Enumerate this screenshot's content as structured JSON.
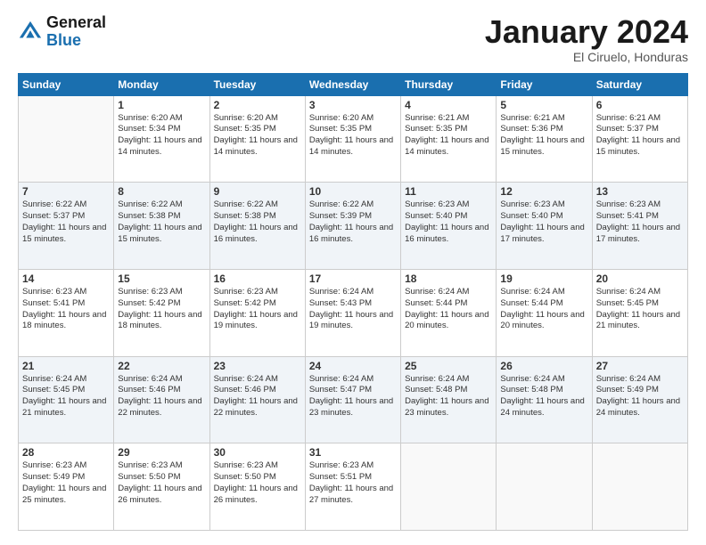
{
  "logo": {
    "general": "General",
    "blue": "Blue"
  },
  "header": {
    "month": "January 2024",
    "location": "El Ciruelo, Honduras"
  },
  "weekdays": [
    "Sunday",
    "Monday",
    "Tuesday",
    "Wednesday",
    "Thursday",
    "Friday",
    "Saturday"
  ],
  "weeks": [
    [
      {
        "day": "",
        "sunrise": "",
        "sunset": "",
        "daylight": ""
      },
      {
        "day": "1",
        "sunrise": "Sunrise: 6:20 AM",
        "sunset": "Sunset: 5:34 PM",
        "daylight": "Daylight: 11 hours and 14 minutes."
      },
      {
        "day": "2",
        "sunrise": "Sunrise: 6:20 AM",
        "sunset": "Sunset: 5:35 PM",
        "daylight": "Daylight: 11 hours and 14 minutes."
      },
      {
        "day": "3",
        "sunrise": "Sunrise: 6:20 AM",
        "sunset": "Sunset: 5:35 PM",
        "daylight": "Daylight: 11 hours and 14 minutes."
      },
      {
        "day": "4",
        "sunrise": "Sunrise: 6:21 AM",
        "sunset": "Sunset: 5:35 PM",
        "daylight": "Daylight: 11 hours and 14 minutes."
      },
      {
        "day": "5",
        "sunrise": "Sunrise: 6:21 AM",
        "sunset": "Sunset: 5:36 PM",
        "daylight": "Daylight: 11 hours and 15 minutes."
      },
      {
        "day": "6",
        "sunrise": "Sunrise: 6:21 AM",
        "sunset": "Sunset: 5:37 PM",
        "daylight": "Daylight: 11 hours and 15 minutes."
      }
    ],
    [
      {
        "day": "7",
        "sunrise": "Sunrise: 6:22 AM",
        "sunset": "Sunset: 5:37 PM",
        "daylight": "Daylight: 11 hours and 15 minutes."
      },
      {
        "day": "8",
        "sunrise": "Sunrise: 6:22 AM",
        "sunset": "Sunset: 5:38 PM",
        "daylight": "Daylight: 11 hours and 15 minutes."
      },
      {
        "day": "9",
        "sunrise": "Sunrise: 6:22 AM",
        "sunset": "Sunset: 5:38 PM",
        "daylight": "Daylight: 11 hours and 16 minutes."
      },
      {
        "day": "10",
        "sunrise": "Sunrise: 6:22 AM",
        "sunset": "Sunset: 5:39 PM",
        "daylight": "Daylight: 11 hours and 16 minutes."
      },
      {
        "day": "11",
        "sunrise": "Sunrise: 6:23 AM",
        "sunset": "Sunset: 5:40 PM",
        "daylight": "Daylight: 11 hours and 16 minutes."
      },
      {
        "day": "12",
        "sunrise": "Sunrise: 6:23 AM",
        "sunset": "Sunset: 5:40 PM",
        "daylight": "Daylight: 11 hours and 17 minutes."
      },
      {
        "day": "13",
        "sunrise": "Sunrise: 6:23 AM",
        "sunset": "Sunset: 5:41 PM",
        "daylight": "Daylight: 11 hours and 17 minutes."
      }
    ],
    [
      {
        "day": "14",
        "sunrise": "Sunrise: 6:23 AM",
        "sunset": "Sunset: 5:41 PM",
        "daylight": "Daylight: 11 hours and 18 minutes."
      },
      {
        "day": "15",
        "sunrise": "Sunrise: 6:23 AM",
        "sunset": "Sunset: 5:42 PM",
        "daylight": "Daylight: 11 hours and 18 minutes."
      },
      {
        "day": "16",
        "sunrise": "Sunrise: 6:23 AM",
        "sunset": "Sunset: 5:42 PM",
        "daylight": "Daylight: 11 hours and 19 minutes."
      },
      {
        "day": "17",
        "sunrise": "Sunrise: 6:24 AM",
        "sunset": "Sunset: 5:43 PM",
        "daylight": "Daylight: 11 hours and 19 minutes."
      },
      {
        "day": "18",
        "sunrise": "Sunrise: 6:24 AM",
        "sunset": "Sunset: 5:44 PM",
        "daylight": "Daylight: 11 hours and 20 minutes."
      },
      {
        "day": "19",
        "sunrise": "Sunrise: 6:24 AM",
        "sunset": "Sunset: 5:44 PM",
        "daylight": "Daylight: 11 hours and 20 minutes."
      },
      {
        "day": "20",
        "sunrise": "Sunrise: 6:24 AM",
        "sunset": "Sunset: 5:45 PM",
        "daylight": "Daylight: 11 hours and 21 minutes."
      }
    ],
    [
      {
        "day": "21",
        "sunrise": "Sunrise: 6:24 AM",
        "sunset": "Sunset: 5:45 PM",
        "daylight": "Daylight: 11 hours and 21 minutes."
      },
      {
        "day": "22",
        "sunrise": "Sunrise: 6:24 AM",
        "sunset": "Sunset: 5:46 PM",
        "daylight": "Daylight: 11 hours and 22 minutes."
      },
      {
        "day": "23",
        "sunrise": "Sunrise: 6:24 AM",
        "sunset": "Sunset: 5:46 PM",
        "daylight": "Daylight: 11 hours and 22 minutes."
      },
      {
        "day": "24",
        "sunrise": "Sunrise: 6:24 AM",
        "sunset": "Sunset: 5:47 PM",
        "daylight": "Daylight: 11 hours and 23 minutes."
      },
      {
        "day": "25",
        "sunrise": "Sunrise: 6:24 AM",
        "sunset": "Sunset: 5:48 PM",
        "daylight": "Daylight: 11 hours and 23 minutes."
      },
      {
        "day": "26",
        "sunrise": "Sunrise: 6:24 AM",
        "sunset": "Sunset: 5:48 PM",
        "daylight": "Daylight: 11 hours and 24 minutes."
      },
      {
        "day": "27",
        "sunrise": "Sunrise: 6:24 AM",
        "sunset": "Sunset: 5:49 PM",
        "daylight": "Daylight: 11 hours and 24 minutes."
      }
    ],
    [
      {
        "day": "28",
        "sunrise": "Sunrise: 6:23 AM",
        "sunset": "Sunset: 5:49 PM",
        "daylight": "Daylight: 11 hours and 25 minutes."
      },
      {
        "day": "29",
        "sunrise": "Sunrise: 6:23 AM",
        "sunset": "Sunset: 5:50 PM",
        "daylight": "Daylight: 11 hours and 26 minutes."
      },
      {
        "day": "30",
        "sunrise": "Sunrise: 6:23 AM",
        "sunset": "Sunset: 5:50 PM",
        "daylight": "Daylight: 11 hours and 26 minutes."
      },
      {
        "day": "31",
        "sunrise": "Sunrise: 6:23 AM",
        "sunset": "Sunset: 5:51 PM",
        "daylight": "Daylight: 11 hours and 27 minutes."
      },
      {
        "day": "",
        "sunrise": "",
        "sunset": "",
        "daylight": ""
      },
      {
        "day": "",
        "sunrise": "",
        "sunset": "",
        "daylight": ""
      },
      {
        "day": "",
        "sunrise": "",
        "sunset": "",
        "daylight": ""
      }
    ]
  ]
}
